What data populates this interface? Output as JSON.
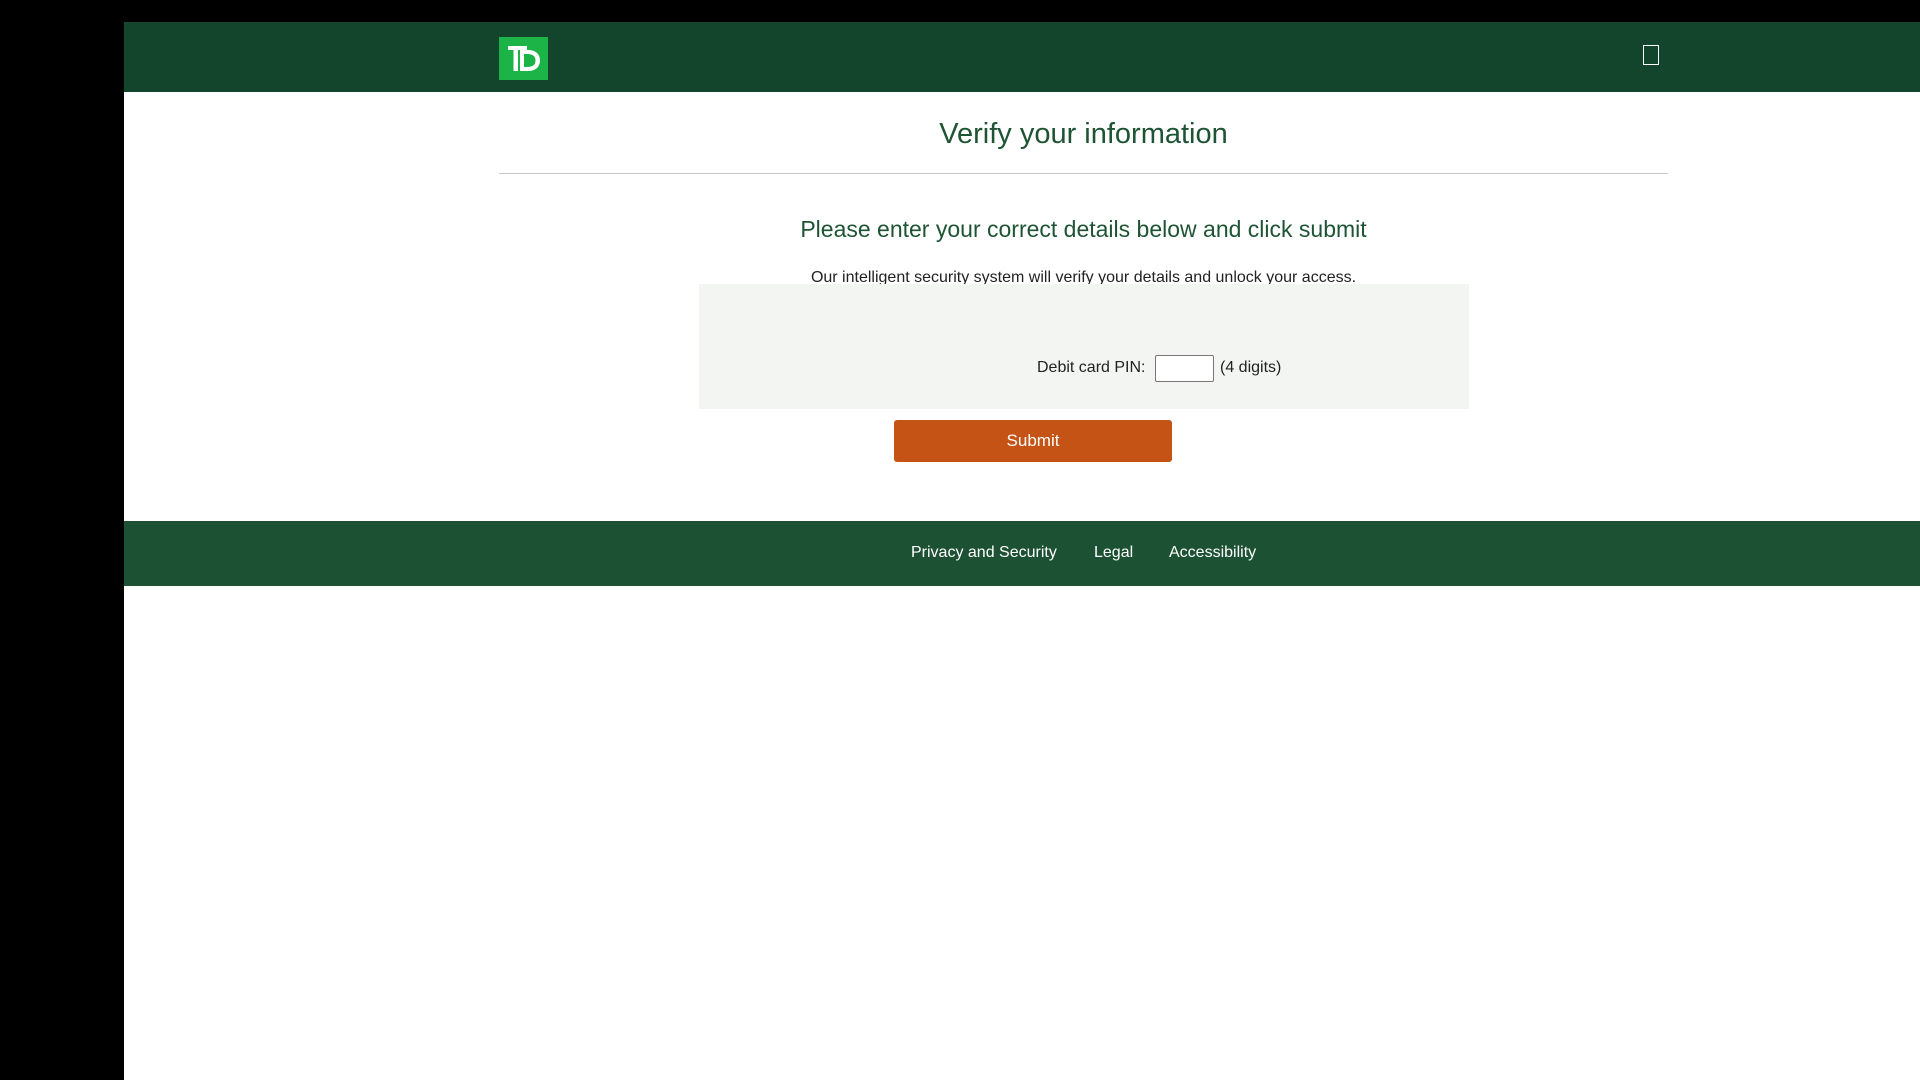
{
  "header": {
    "logo_text": "TD",
    "logo_color": "#1db447",
    "background": "#13452d",
    "menu_icon": "menu-square-icon"
  },
  "main": {
    "title": "Verify your information",
    "subtitle": "Please enter your correct details below and click submit",
    "description": "Our intelligent security system will verify your details and unlock your access.",
    "form": {
      "pin_label": "Debit card PIN:",
      "pin_value": "",
      "pin_hint": "(4 digits)"
    },
    "submit_label": "Submit",
    "submit_color": "#c65316"
  },
  "footer": {
    "background": "#1c5133",
    "links": [
      {
        "label": "Privacy and Security"
      },
      {
        "label": "Legal"
      },
      {
        "label": "Accessibility"
      }
    ]
  }
}
